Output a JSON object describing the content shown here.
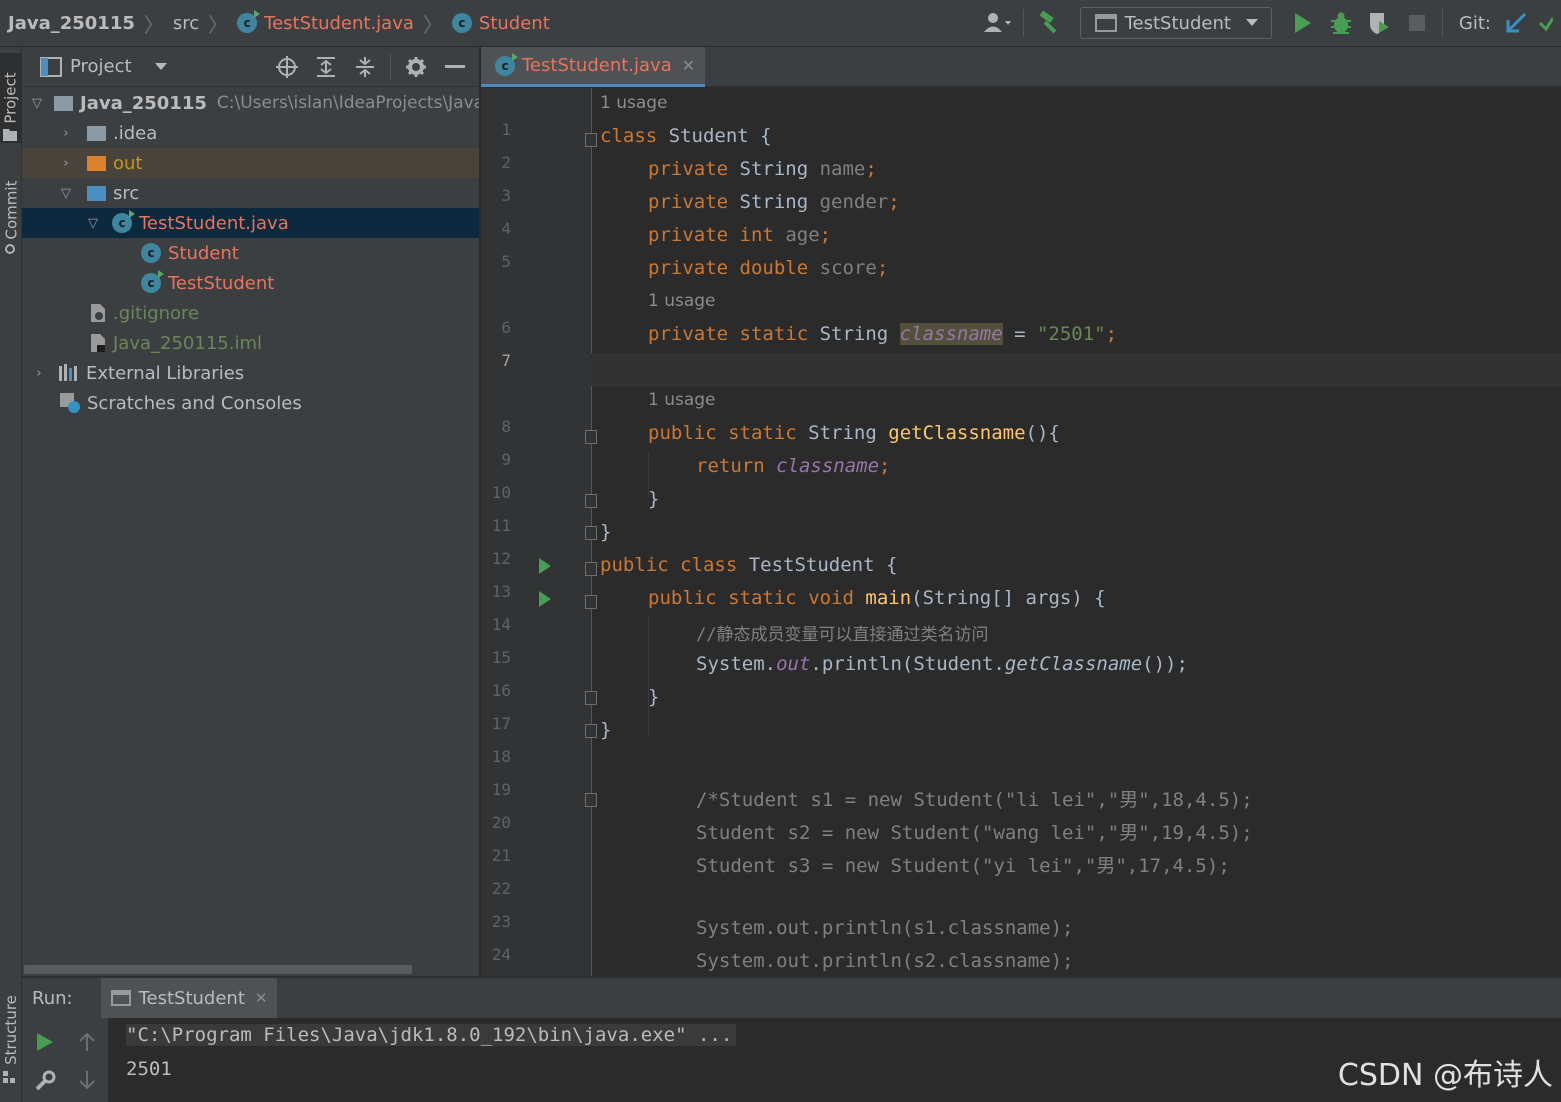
{
  "breadcrumb": {
    "root": "Java_250115",
    "src": "src",
    "file": "TestStudent.java",
    "class": "Student"
  },
  "toolbar": {
    "run_config": "TestStudent",
    "git_label": "Git:"
  },
  "left_strip": {
    "project_tab": "Project",
    "commit_tab": "Commit",
    "structure_tab": "Structure"
  },
  "project_panel": {
    "title": "Project",
    "tree": [
      {
        "label": "Java_250115",
        "path": "C:\\Users\\islan\\IdeaProjects\\Java"
      },
      {
        "label": ".idea"
      },
      {
        "label": "out"
      },
      {
        "label": "src"
      },
      {
        "label": "TestStudent.java"
      },
      {
        "label": "Student"
      },
      {
        "label": "TestStudent"
      },
      {
        "label": ".gitignore"
      },
      {
        "label": "Java_250115.iml"
      },
      {
        "label": "External Libraries"
      },
      {
        "label": "Scratches and Consoles"
      }
    ]
  },
  "editor": {
    "tab": "TestStudent.java",
    "usage_hint": "1 usage",
    "line_numbers": [
      "1",
      "2",
      "3",
      "4",
      "5",
      "6",
      "7",
      "8",
      "9",
      "10",
      "11",
      "12",
      "13",
      "14",
      "15",
      "16",
      "17",
      "18",
      "19",
      "20",
      "21",
      "22",
      "23",
      "24"
    ],
    "code": {
      "l1": [
        "class",
        " Student {"
      ],
      "l2": [
        "private",
        " String ",
        "name",
        ";"
      ],
      "l3": [
        "private",
        " String ",
        "gender",
        ";"
      ],
      "l4": [
        "private",
        " ",
        "int",
        " ",
        "age",
        ";"
      ],
      "l5": [
        "private",
        " ",
        "double",
        " ",
        "score",
        ";"
      ],
      "l6": [
        "private",
        " ",
        "static",
        " String ",
        "classname",
        " = ",
        "\"2501\"",
        ";"
      ],
      "l8": [
        "public",
        " ",
        "static",
        " String ",
        "getClassname",
        "(){"
      ],
      "l9": [
        "return",
        " ",
        "classname",
        ";"
      ],
      "l10": "}",
      "l11": "}",
      "l12": [
        "public",
        " ",
        "class",
        " TestStudent {"
      ],
      "l13": [
        "public",
        " ",
        "static",
        " ",
        "void",
        " ",
        "main",
        "(String[] args) {"
      ],
      "l14": "//静态成员变量可以直接通过类名访问",
      "l15": [
        "System.",
        "out",
        ".println(Student.",
        "getClassname",
        "());"
      ],
      "l16": "}",
      "l17": "}",
      "l19": "/*Student s1 = new Student(\"li lei\",\"男\",18,4.5);",
      "l20": "Student s2 = new Student(\"wang lei\",\"男\",19,4.5);",
      "l21": "Student s3 = new Student(\"yi lei\",\"男\",17,4.5);",
      "l23": "System.out.println(s1.classname);",
      "l24": "System.out.println(s2.classname);"
    }
  },
  "run_panel": {
    "label": "Run:",
    "tab": "TestStudent",
    "console": [
      "\"C:\\Program Files\\Java\\jdk1.8.0_192\\bin\\java.exe\" ...",
      "2501"
    ]
  },
  "watermark": "CSDN @布诗人",
  "colors": {
    "keyword": "#cc7832",
    "field": "#9876aa",
    "string": "#6a8759",
    "method": "#ffc66d",
    "comment": "#808080",
    "default": "#a9b7c6",
    "run_green": "#499c54",
    "file_red": "#e8745e"
  }
}
